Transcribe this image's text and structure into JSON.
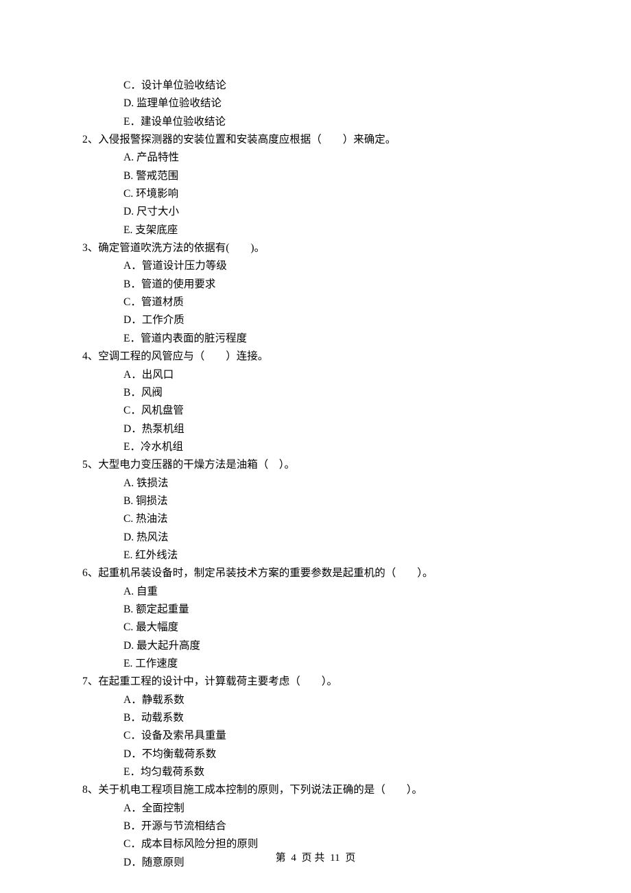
{
  "orphan_options": [
    "C．设计单位验收结论",
    "D. 监理单位验收结论",
    "E．建设单位验收结论"
  ],
  "questions": [
    {
      "stem": "2、入侵报警探测器的安装位置和安装高度应根据（　　）来确定。",
      "options": [
        "A. 产品特性",
        "B. 警戒范围",
        "C. 环境影响",
        "D. 尺寸大小",
        "E. 支架底座"
      ]
    },
    {
      "stem": "3、确定管道吹洗方法的依据有(　　)。",
      "options": [
        "A．管道设计压力等级",
        "B．管道的使用要求",
        "C．管道材质",
        "D．工作介质",
        "E．管道内表面的脏污程度"
      ]
    },
    {
      "stem": "4、空调工程的风管应与（　　）连接。",
      "options": [
        "A．出风口",
        "B．风阀",
        "C．风机盘管",
        "D．热泵机组",
        "E．冷水机组"
      ]
    },
    {
      "stem": "5、大型电力变压器的干燥方法是油箱（　）。",
      "options": [
        "A. 铁损法",
        "B. 铜损法",
        "C. 热油法",
        "D. 热风法",
        "E. 红外线法"
      ]
    },
    {
      "stem": "6、起重机吊装设备时，制定吊装技术方案的重要参数是起重机的（　　）。",
      "options": [
        "A. 自重",
        "B. 额定起重量",
        "C. 最大幅度",
        "D. 最大起升高度",
        "E. 工作速度"
      ]
    },
    {
      "stem": "7、在起重工程的设计中，计算载荷主要考虑（　　）。",
      "options": [
        "A．静载系数",
        "B．动载系数",
        "C．设备及索吊具重量",
        "D．不均衡载荷系数",
        "E．均匀载荷系数"
      ]
    },
    {
      "stem": "8、关于机电工程项目施工成本控制的原则，下列说法正确的是（　　）。",
      "options": [
        "A．全面控制",
        "B．开源与节流相结合",
        "C．成本目标风险分担的原则",
        "D．随意原则"
      ]
    }
  ],
  "footer": {
    "prefix": "第",
    "page": "4",
    "mid": "页 共",
    "total": "11",
    "suffix": "页"
  }
}
